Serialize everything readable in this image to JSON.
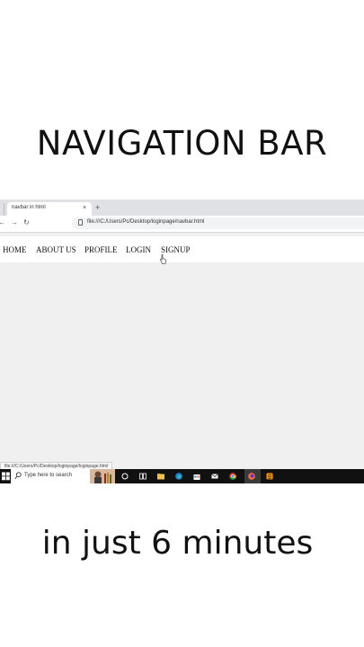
{
  "captions": {
    "top": "NAVIGATION BAR",
    "bottom": "in just 6 minutes"
  },
  "browser": {
    "tab_title": "navbar in html",
    "tab_close": "×",
    "new_tab": "+",
    "url": "file:///C:/Users/Pc/Desktop/loginpage/navbar.html",
    "status_url": "file:///C:/Users/Pc/Desktop/loginpage/loginpage.html"
  },
  "navbar": {
    "links": [
      "HOME",
      "ABOUT US",
      "PROFILE",
      "LOGIN",
      "SIGNUP"
    ]
  },
  "taskbar": {
    "search_placeholder": "Type here to search",
    "icons": [
      "windows-icon",
      "cortana-icon",
      "task-view-icon",
      "file-explorer-icon",
      "edge-icon",
      "store-icon",
      "mail-icon",
      "chrome-icon",
      "firefox-icon",
      "sublime-icon"
    ]
  },
  "colors": {
    "taskbar": "#111111",
    "page_background": "#f0f0f0",
    "navbar_background": "#ffffff"
  }
}
